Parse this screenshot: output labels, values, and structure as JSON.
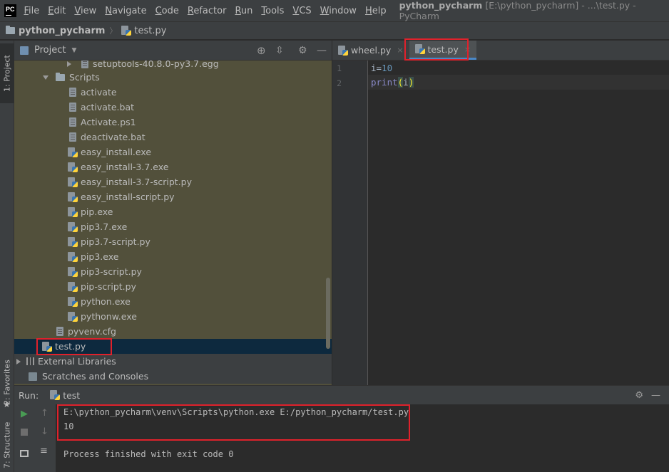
{
  "menubar": {
    "items": [
      {
        "u": "F",
        "rest": "ile"
      },
      {
        "u": "E",
        "rest": "dit"
      },
      {
        "u": "V",
        "rest": "iew"
      },
      {
        "u": "N",
        "rest": "avigate"
      },
      {
        "u": "C",
        "rest": "ode"
      },
      {
        "u": "R",
        "rest": "efactor"
      },
      {
        "u": "R",
        "rest": "un"
      },
      {
        "u": "T",
        "rest": "ools"
      },
      {
        "u": "V",
        "rest": "CS"
      },
      {
        "u": "W",
        "rest": "indow"
      },
      {
        "u": "H",
        "rest": "elp"
      }
    ],
    "title_project": "python_pycharm",
    "title_rest": "[E:\\python_pycharm] - ...\\test.py - PyCharm",
    "logo": "PC"
  },
  "breadcrumb": {
    "project": "python_pycharm",
    "file": "test.py"
  },
  "leftstrip": {
    "project_tab": "1: Project",
    "favorites_tab": "2: Favorites",
    "structure_tab": "7: Structure"
  },
  "project_panel": {
    "title": "Project",
    "tree": [
      {
        "label": "setuptools-40.8.0-py3.7.egg",
        "icon": "file"
      },
      {
        "label": "Scripts",
        "icon": "folder"
      },
      {
        "label": "activate",
        "icon": "file"
      },
      {
        "label": "activate.bat",
        "icon": "file"
      },
      {
        "label": "Activate.ps1",
        "icon": "file"
      },
      {
        "label": "deactivate.bat",
        "icon": "file"
      },
      {
        "label": "easy_install.exe",
        "icon": "py"
      },
      {
        "label": "easy_install-3.7.exe",
        "icon": "py"
      },
      {
        "label": "easy_install-3.7-script.py",
        "icon": "py"
      },
      {
        "label": "easy_install-script.py",
        "icon": "py"
      },
      {
        "label": "pip.exe",
        "icon": "py"
      },
      {
        "label": "pip3.7.exe",
        "icon": "py"
      },
      {
        "label": "pip3.7-script.py",
        "icon": "py"
      },
      {
        "label": "pip3.exe",
        "icon": "py"
      },
      {
        "label": "pip3-script.py",
        "icon": "py"
      },
      {
        "label": "pip-script.py",
        "icon": "py"
      },
      {
        "label": "python.exe",
        "icon": "py"
      },
      {
        "label": "pythonw.exe",
        "icon": "py"
      },
      {
        "label": "pyvenv.cfg",
        "icon": "file"
      },
      {
        "label": "test.py",
        "icon": "py"
      },
      {
        "label": "External Libraries",
        "icon": "lib"
      },
      {
        "label": "Scratches and Consoles",
        "icon": "scratch"
      }
    ]
  },
  "editor": {
    "tabs": [
      {
        "label": "wheel.py",
        "close": "×"
      },
      {
        "label": "test.py",
        "close": "×"
      }
    ],
    "lines": [
      {
        "number": "1",
        "var": "i",
        "op": "=",
        "value": "10"
      },
      {
        "number": "2",
        "fn": "print",
        "open": "(",
        "arg": "i",
        "close": ")"
      }
    ]
  },
  "run": {
    "label": "Run:",
    "config": "test",
    "output": [
      "E:\\python_pycharm\\venv\\Scripts\\python.exe E:/python_pycharm/test.py",
      "10",
      "Process finished with exit code 0"
    ]
  },
  "colors": {
    "highlight_box": "#e0212b",
    "selection": "#0d293e",
    "accent": "#4a88c7"
  }
}
